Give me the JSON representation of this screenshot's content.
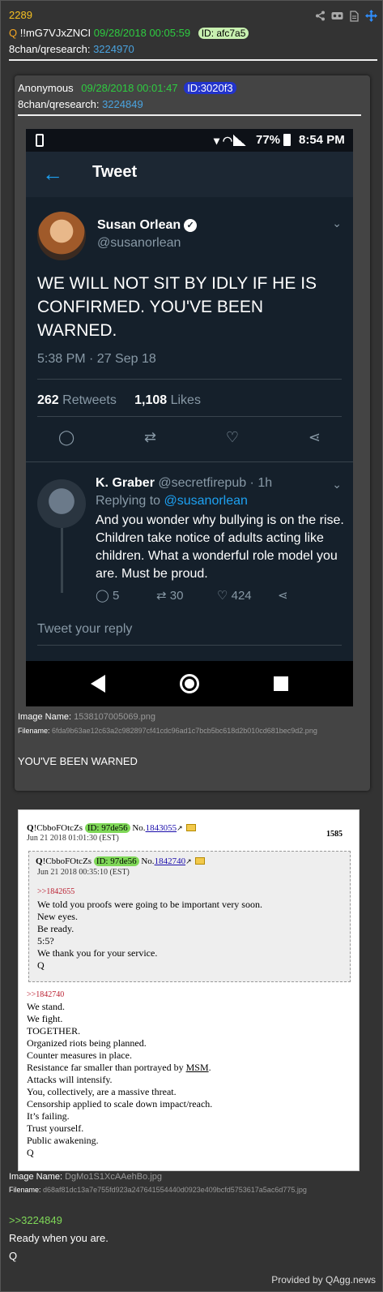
{
  "post": {
    "number": "2289",
    "q_marker": "Q",
    "tripcode": "!!mG7VJxZNCI",
    "datetime": "09/28/2018 00:05:59",
    "id": "ID: afc7a5",
    "board": "8chan/qresearch:",
    "thread_link": "3224970"
  },
  "quoted": {
    "author": "Anonymous",
    "datetime": "09/28/2018 00:01:47",
    "id": "ID:3020f3",
    "board": "8chan/qresearch:",
    "thread_link": "3224849",
    "image_name_label": "Image Name:",
    "image_name": "1538107005069.png",
    "filename_label": "Filename:",
    "filename": "6fda9b63ae12c63a2c982897cf41cdc96ad1c7bcb5bc618d2b010cd681bec9d2.png",
    "caption": "YOU'VE BEEN WARNED"
  },
  "phone": {
    "battery_pct": "77%",
    "time": "8:54 PM",
    "app_title": "Tweet",
    "user_name": "Susan Orlean",
    "user_handle": "@susanorlean",
    "tweet_text": "WE WILL NOT SIT BY IDLY IF HE IS CONFIRMED. YOU'VE BEEN WARNED.",
    "tweet_time": "5:38 PM · 27 Sep 18",
    "retweets_count": "262",
    "retweets_label": "Retweets",
    "likes_count": "1,108",
    "likes_label": "Likes",
    "reply_name": "K. Graber",
    "reply_handle_time": "@secretfirepub · 1h",
    "replying_to_label": "Replying to",
    "replying_to_handle": "@susanorlean",
    "reply_text": "And you wonder why bullying is on the rise.  Children take notice of adults acting like children.  What a wonderful role model you are.  Must be proud.",
    "reply_replies": "5",
    "reply_retweets": "30",
    "reply_likes": "424",
    "compose_placeholder": "Tweet your reply"
  },
  "doc": {
    "q": "Q",
    "trip": "!CbboFOtcZs",
    "id": "ID: 97de56",
    "no_label": "No.",
    "no": "1843055",
    "date": "Jun 21 2018 01:01:30 (EST)",
    "page": "1585",
    "quote_trip": "!CbboFOtcZs",
    "quote_id": "ID: 97de56",
    "quote_no": "1842740",
    "quote_date": "Jun 21 2018 00:35:10 (EST)",
    "quote_ref": ">>1842655",
    "quote_lines": [
      "We told you proofs were going to be important very soon.",
      "New eyes.",
      "Be ready.",
      "5:5?",
      "We thank you for your service.",
      "Q"
    ],
    "main_ref": ">>1842740",
    "main_lines": [
      "We stand.",
      "We fight.",
      "TOGETHER.",
      "Organized riots being planned.",
      "Counter measures in place.",
      "Resistance far smaller than portrayed by MSM.",
      "Attacks will intensify.",
      "You, collectively, are a massive threat.",
      "Censorship applied to scale down impact/reach.",
      "It’s failing.",
      "Trust yourself.",
      "Public awakening.",
      "Q"
    ]
  },
  "attachment2": {
    "image_name_label": "Image Name:",
    "image_name": "DgMo1S1XcAAehBo.jpg",
    "filename_label": "Filename:",
    "filename": "d68af81dc13a7e755fd923a247641554440d0923e409bcfd5753617a5ac6d775.jpg"
  },
  "footer": {
    "greentext": ">>3224849",
    "message": "Ready when you are.",
    "signature": "Q",
    "provided_by": "Provided by QAgg.news"
  },
  "icons": [
    "share-icon",
    "vr-icon",
    "document-icon",
    "move-icon"
  ]
}
